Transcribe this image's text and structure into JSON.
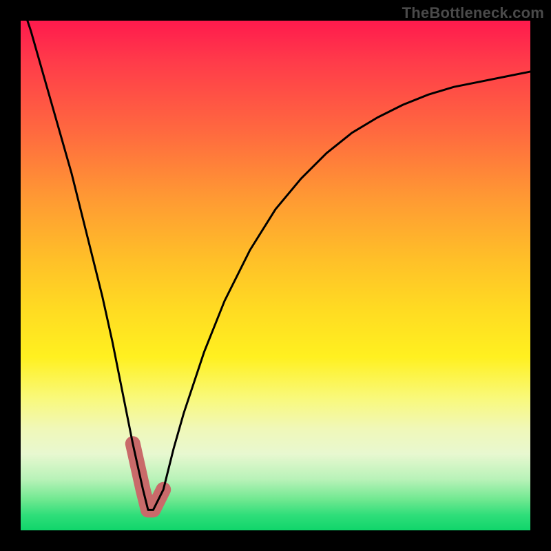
{
  "watermark": "TheBottleneck.com",
  "chart_data": {
    "type": "line",
    "title": "",
    "xlabel": "",
    "ylabel": "",
    "xlim": [
      0,
      100
    ],
    "ylim": [
      0,
      100
    ],
    "x": [
      0,
      2,
      4,
      6,
      8,
      10,
      12,
      14,
      16,
      18,
      20,
      22,
      24,
      25,
      26,
      28,
      30,
      32,
      36,
      40,
      45,
      50,
      55,
      60,
      65,
      70,
      75,
      80,
      85,
      90,
      95,
      100
    ],
    "values": [
      104,
      98,
      91,
      84,
      77,
      70,
      62,
      54,
      46,
      37,
      27,
      17,
      8,
      4,
      4,
      8,
      16,
      23,
      35,
      45,
      55,
      63,
      69,
      74,
      78,
      81,
      83.5,
      85.5,
      87,
      88,
      89,
      90
    ],
    "highlight_range_x": [
      22,
      28
    ],
    "gradient_stops": [
      {
        "pos": 0,
        "color": "#ff1a4d"
      },
      {
        "pos": 35,
        "color": "#ff9a33"
      },
      {
        "pos": 66,
        "color": "#fff020"
      },
      {
        "pos": 100,
        "color": "#10d56a"
      }
    ]
  }
}
